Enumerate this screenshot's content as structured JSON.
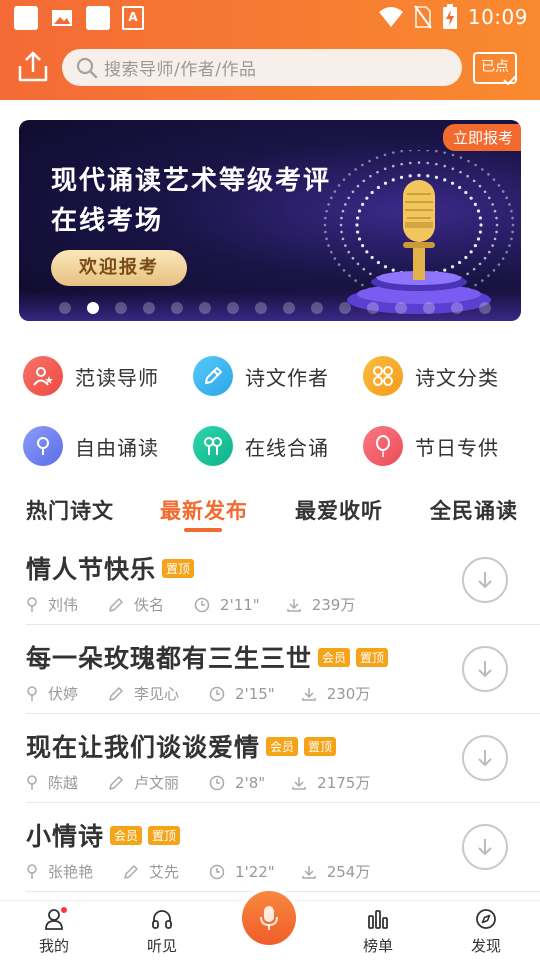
{
  "status_bar": {
    "time": "10:09",
    "app_icon_letter": "A"
  },
  "header": {
    "search_placeholder": "搜索导师/作者/作品",
    "signin_label": "已点"
  },
  "banner": {
    "tag": "立即报考",
    "title_line1": "现代诵读艺术等级考评",
    "title_line2": "在线考场",
    "button": "欢迎报考",
    "dots_count": 16,
    "active_dot": 2
  },
  "categories": [
    {
      "label": "范读导师",
      "icon": "teacher-icon",
      "color": "#f0564a"
    },
    {
      "label": "诗文作者",
      "icon": "pen-icon",
      "color": "#2fb4ef"
    },
    {
      "label": "诗文分类",
      "icon": "grid-icon",
      "color": "#f8a51f"
    },
    {
      "label": "自由诵读",
      "icon": "mic-icon",
      "color": "#6c7ef0"
    },
    {
      "label": "在线合诵",
      "icon": "duet-icon",
      "color": "#16c19a"
    },
    {
      "label": "节日专供",
      "icon": "balloon-icon",
      "color": "#f25a66"
    }
  ],
  "tabs": [
    {
      "label": "热门诗文"
    },
    {
      "label": "最新发布"
    },
    {
      "label": "最爱收听"
    },
    {
      "label": "全民诵读"
    }
  ],
  "active_tab": 1,
  "list": [
    {
      "title": "情人节快乐",
      "badges": [
        "置顶"
      ],
      "reader": "刘伟",
      "author": "佚名",
      "duration": "2'11\"",
      "plays": "239万"
    },
    {
      "title": "每一朵玫瑰都有三生三世",
      "badges": [
        "会员",
        "置顶"
      ],
      "reader": "伏婷",
      "author": "李见心",
      "duration": "2'15\"",
      "plays": "230万"
    },
    {
      "title": "现在让我们谈谈爱情",
      "badges": [
        "会员",
        "置顶"
      ],
      "reader": "陈越",
      "author": "卢文丽",
      "duration": "2'8\"",
      "plays": "2175万"
    },
    {
      "title": "小情诗",
      "badges": [
        "会员",
        "置顶"
      ],
      "reader": "张艳艳",
      "author": "艾先",
      "duration": "1'22\"",
      "plays": "254万"
    }
  ],
  "bottom_nav": [
    {
      "label": "我的",
      "icon": "user-icon"
    },
    {
      "label": "听见",
      "icon": "headphones-icon"
    },
    {
      "label": "榜单",
      "icon": "chart-icon"
    },
    {
      "label": "发现",
      "icon": "compass-icon"
    }
  ],
  "colors": {
    "accent": "#f36a2e",
    "badge": "#f5a318"
  }
}
